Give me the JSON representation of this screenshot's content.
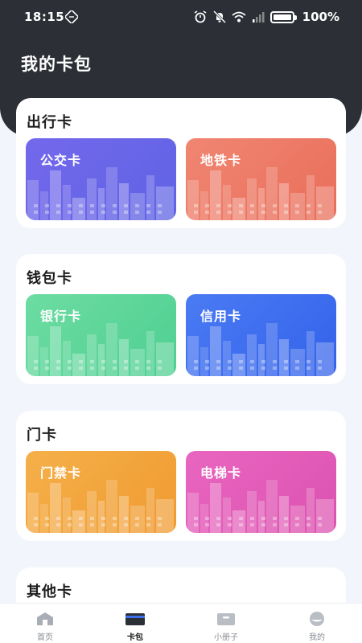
{
  "status": {
    "time": "18:15",
    "battery": "100%"
  },
  "header": {
    "title": "我的卡包"
  },
  "sections": [
    {
      "title": "出行卡",
      "cards": [
        {
          "label": "公交卡",
          "color": "#6b63e8"
        },
        {
          "label": "地铁卡",
          "color": "#ee7a66"
        }
      ]
    },
    {
      "title": "钱包卡",
      "cards": [
        {
          "label": "银行卡",
          "color": "#62d69a"
        },
        {
          "label": "信用卡",
          "color": "#3e6ff0"
        }
      ]
    },
    {
      "title": "门卡",
      "cards": [
        {
          "label": "门禁卡",
          "color": "#f2a83e"
        },
        {
          "label": "电梯卡",
          "color": "#e45fb8"
        }
      ]
    },
    {
      "title": "其他卡",
      "cards": []
    }
  ],
  "bottom_nav": {
    "items": [
      {
        "label": "首页",
        "icon": "home-icon",
        "active": false
      },
      {
        "label": "卡包",
        "icon": "wallet-icon",
        "active": true
      },
      {
        "label": "小册子",
        "icon": "booklet-icon",
        "active": false
      },
      {
        "label": "我的",
        "icon": "profile-icon",
        "active": false
      }
    ]
  }
}
